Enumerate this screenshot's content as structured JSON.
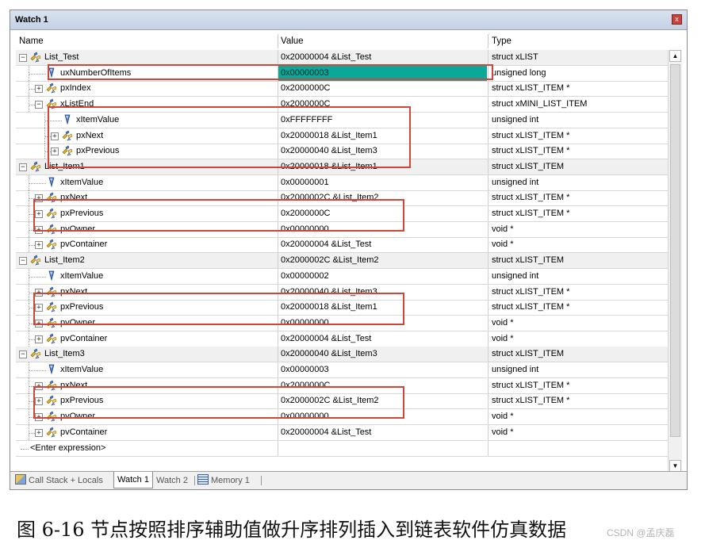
{
  "window": {
    "title": "Watch 1",
    "close_label": "x"
  },
  "columns": {
    "name": "Name",
    "value": "Value",
    "type": "Type"
  },
  "rows": [
    {
      "name": "List_Test",
      "value": "0x20000004 &List_Test",
      "type": "struct xLIST",
      "level": 0,
      "expander": "minus",
      "icon": "struct-icon"
    },
    {
      "name": "uxNumberOfItems",
      "value": "0x00000003",
      "type": "unsigned long",
      "level": 1,
      "expander": "none",
      "icon": "variable-icon",
      "highlight": true
    },
    {
      "name": "pxIndex",
      "value": "0x2000000C",
      "type": "struct xLIST_ITEM *",
      "level": 1,
      "expander": "plus",
      "icon": "struct-icon"
    },
    {
      "name": "xListEnd",
      "value": "0x2000000C",
      "type": "struct xMINI_LIST_ITEM",
      "level": 1,
      "expander": "minus",
      "icon": "struct-icon"
    },
    {
      "name": "xItemValue",
      "value": "0xFFFFFFFF",
      "type": "unsigned int",
      "level": 2,
      "expander": "none",
      "icon": "variable-icon"
    },
    {
      "name": "pxNext",
      "value": "0x20000018 &List_Item1",
      "type": "struct xLIST_ITEM *",
      "level": 2,
      "expander": "plus",
      "icon": "struct-icon"
    },
    {
      "name": "pxPrevious",
      "value": "0x20000040 &List_Item3",
      "type": "struct xLIST_ITEM *",
      "level": 2,
      "expander": "plus",
      "icon": "struct-icon"
    },
    {
      "name": "List_Item1",
      "value": "0x20000018 &List_Item1",
      "type": "struct xLIST_ITEM",
      "level": 0,
      "expander": "minus",
      "icon": "struct-icon"
    },
    {
      "name": "xItemValue",
      "value": "0x00000001",
      "type": "unsigned int",
      "level": 1,
      "expander": "none",
      "icon": "variable-icon"
    },
    {
      "name": "pxNext",
      "value": "0x2000002C &List_Item2",
      "type": "struct xLIST_ITEM *",
      "level": 1,
      "expander": "plus",
      "icon": "struct-icon"
    },
    {
      "name": "pxPrevious",
      "value": "0x2000000C",
      "type": "struct xLIST_ITEM *",
      "level": 1,
      "expander": "plus",
      "icon": "struct-icon"
    },
    {
      "name": "pvOwner",
      "value": "0x00000000",
      "type": "void *",
      "level": 1,
      "expander": "plus",
      "icon": "struct-icon"
    },
    {
      "name": "pvContainer",
      "value": "0x20000004 &List_Test",
      "type": "void *",
      "level": 1,
      "expander": "plus",
      "icon": "struct-icon"
    },
    {
      "name": "List_Item2",
      "value": "0x2000002C &List_Item2",
      "type": "struct xLIST_ITEM",
      "level": 0,
      "expander": "minus",
      "icon": "struct-icon"
    },
    {
      "name": "xItemValue",
      "value": "0x00000002",
      "type": "unsigned int",
      "level": 1,
      "expander": "none",
      "icon": "variable-icon"
    },
    {
      "name": "pxNext",
      "value": "0x20000040 &List_Item3",
      "type": "struct xLIST_ITEM *",
      "level": 1,
      "expander": "plus",
      "icon": "struct-icon"
    },
    {
      "name": "pxPrevious",
      "value": "0x20000018 &List_Item1",
      "type": "struct xLIST_ITEM *",
      "level": 1,
      "expander": "plus",
      "icon": "struct-icon"
    },
    {
      "name": "pvOwner",
      "value": "0x00000000",
      "type": "void *",
      "level": 1,
      "expander": "plus",
      "icon": "struct-icon"
    },
    {
      "name": "pvContainer",
      "value": "0x20000004 &List_Test",
      "type": "void *",
      "level": 1,
      "expander": "plus",
      "icon": "struct-icon"
    },
    {
      "name": "List_Item3",
      "value": "0x20000040 &List_Item3",
      "type": "struct xLIST_ITEM",
      "level": 0,
      "expander": "minus",
      "icon": "struct-icon"
    },
    {
      "name": "xItemValue",
      "value": "0x00000003",
      "type": "unsigned int",
      "level": 1,
      "expander": "none",
      "icon": "variable-icon"
    },
    {
      "name": "pxNext",
      "value": "0x2000000C",
      "type": "struct xLIST_ITEM *",
      "level": 1,
      "expander": "plus",
      "icon": "struct-icon"
    },
    {
      "name": "pxPrevious",
      "value": "0x2000002C &List_Item2",
      "type": "struct xLIST_ITEM *",
      "level": 1,
      "expander": "plus",
      "icon": "struct-icon"
    },
    {
      "name": "pvOwner",
      "value": "0x00000000",
      "type": "void *",
      "level": 1,
      "expander": "plus",
      "icon": "struct-icon"
    },
    {
      "name": "pvContainer",
      "value": "0x20000004 &List_Test",
      "type": "void *",
      "level": 1,
      "expander": "plus",
      "icon": "struct-icon"
    },
    {
      "name": "<Enter expression>",
      "value": "",
      "type": "",
      "level": 0,
      "expander": "none",
      "icon": "none"
    }
  ],
  "tabs": [
    {
      "label": "Call Stack + Locals",
      "icon": "call-stack-icon",
      "active": false
    },
    {
      "label": "Watch 1",
      "active": true
    },
    {
      "label": "Watch 2",
      "active": false
    },
    {
      "label": "Memory 1",
      "icon": "memory-icon",
      "active": false
    }
  ],
  "caption": "图 6-16 节点按照排序辅助值做升序排列插入到链表软件仿真数据",
  "watermark": "CSDN @孟庆磊",
  "colors": {
    "highlight": "#0ba89a",
    "annotation_box": "#d0473a",
    "titlebar": "#c3d1e4"
  }
}
